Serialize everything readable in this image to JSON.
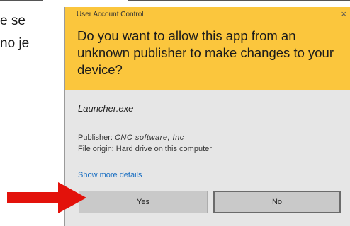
{
  "background_text": {
    "line1": "e se",
    "line2": "no je"
  },
  "dialog": {
    "window_title": "User Account Control",
    "close_glyph": "×",
    "question": "Do you want to allow this app from an unknown publisher to make changes to your device?",
    "app_name": "Launcher.exe",
    "publisher_label": "Publisher:",
    "publisher_value": "CNC software, Inc",
    "file_origin": "File origin: Hard drive on this computer",
    "show_more": "Show more details",
    "yes_label": "Yes",
    "no_label": "No"
  },
  "colors": {
    "header_yellow": "#fbc63d",
    "body_gray": "#e6e6e6",
    "link_blue": "#1a6fc2",
    "arrow_red": "#e3120b"
  },
  "icons": {
    "close": "close-icon",
    "arrow": "red-arrow-icon"
  }
}
